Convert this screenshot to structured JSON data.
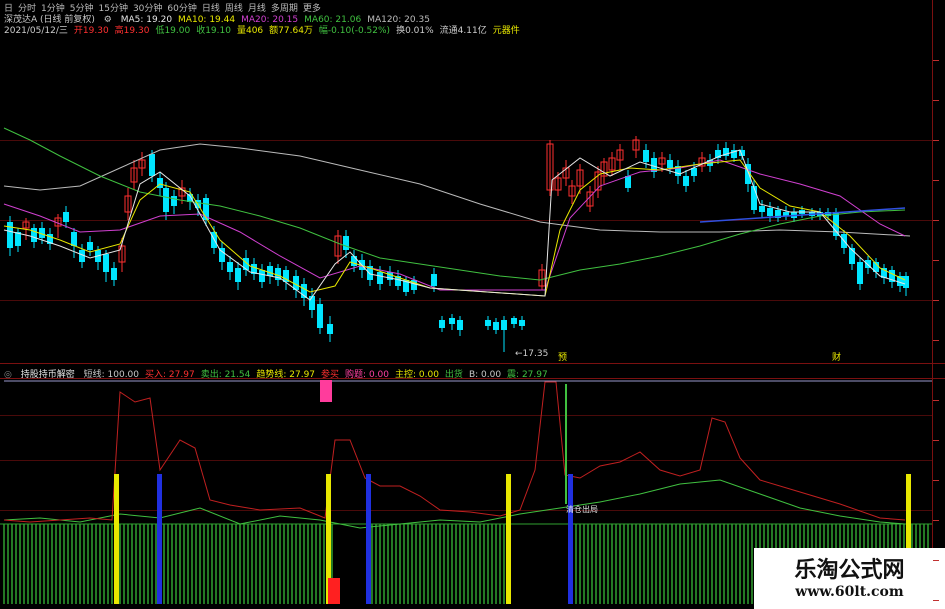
{
  "toolbar": {
    "items": [
      "日",
      "分时",
      "1分钟",
      "5分钟",
      "15分钟",
      "30分钟",
      "60分钟",
      "日线",
      "周线",
      "月线",
      "多周期",
      "更多"
    ]
  },
  "main_panel": {
    "stock": "深茂达A (日线 前复权)",
    "ma": [
      {
        "label": "MA5: 19.20",
        "color": "#e6e6e6"
      },
      {
        "label": "MA10: 19.44",
        "color": "#e8e800"
      },
      {
        "label": "MA20: 20.15",
        "color": "#d040d0"
      },
      {
        "label": "MA60: 21.06",
        "color": "#40c040"
      },
      {
        "label": "MA120: 20.35",
        "color": "#bbbbbb"
      }
    ],
    "quote": [
      {
        "label": "2021/05/12/三",
        "color": "#cccccc"
      },
      {
        "label": "开19.30",
        "color": "#ff3030"
      },
      {
        "label": "高19.30",
        "color": "#ff3030"
      },
      {
        "label": "低19.00",
        "color": "#40c040"
      },
      {
        "label": "收19.10",
        "color": "#40c040"
      },
      {
        "label": "量406",
        "color": "#e8e800"
      },
      {
        "label": "额77.64万",
        "color": "#e8e800"
      },
      {
        "label": "幅-0.10(-0.52%)",
        "color": "#40c040"
      },
      {
        "label": "换0.01%",
        "color": "#cccccc"
      },
      {
        "label": "流通4.11亿",
        "color": "#cccccc"
      },
      {
        "label": "元器件",
        "color": "#e8e800"
      }
    ],
    "annotations": {
      "low_price": "17.35",
      "marker_a": "预",
      "marker_b": "财"
    }
  },
  "indicator_panel": {
    "name": "持股持币解密",
    "values": [
      {
        "label": "短线: 100.00",
        "color": "#c8c8c8"
      },
      {
        "label": "买入: 27.97",
        "color": "#ff3030"
      },
      {
        "label": "卖出: 21.54",
        "color": "#40c040"
      },
      {
        "label": "趋势线: 27.97",
        "color": "#e8e800"
      },
      {
        "label": "参买",
        "color": "#ff3030"
      },
      {
        "label": "购题: 0.00",
        "color": "#ff40a0"
      },
      {
        "label": "主控: 0.00",
        "color": "#e8e800"
      },
      {
        "label": "出货",
        "color": "#40c040"
      },
      {
        "label": "B: 0.00",
        "color": "#c8c8c8"
      },
      {
        "label": "震: 27.97",
        "color": "#40c040"
      }
    ],
    "signal_text": "清仓出局"
  },
  "watermark": {
    "title": "乐淘公式网",
    "url": "www.60lt.com"
  },
  "colors": {
    "up": "#ff3030",
    "down": "#00e5ff",
    "grid": "#4a0a0a",
    "hold_bar": "#30a030"
  }
}
